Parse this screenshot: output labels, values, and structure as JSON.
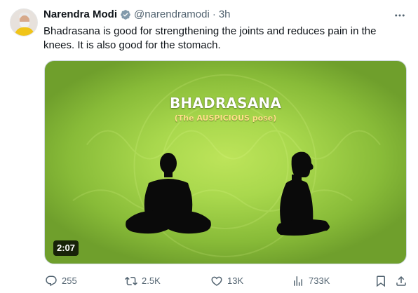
{
  "author": {
    "name": "Narendra Modi",
    "handle": "@narendramodi",
    "separator": "·",
    "time": "3h"
  },
  "tweet": {
    "text": "Bhadrasana is good for strengthening the joints and reduces pain in the knees. It is also good for the stomach."
  },
  "media": {
    "title": "BHADRASANA",
    "subtitle": "(The AUSPICIOUS pose)",
    "duration": "2:07",
    "background_color": "#a9d84d"
  },
  "actions": {
    "replies": "255",
    "reposts": "2.5K",
    "likes": "13K",
    "views": "733K"
  },
  "icons": {
    "verified": "verified-badge-icon",
    "more": "more-options-icon",
    "reply": "reply-icon",
    "repost": "repost-icon",
    "like": "heart-icon",
    "views": "views-chart-icon",
    "bookmark": "bookmark-icon",
    "share": "share-icon"
  },
  "colors": {
    "text": "#0f1419",
    "secondary": "#536471",
    "verified": "#829aab"
  }
}
